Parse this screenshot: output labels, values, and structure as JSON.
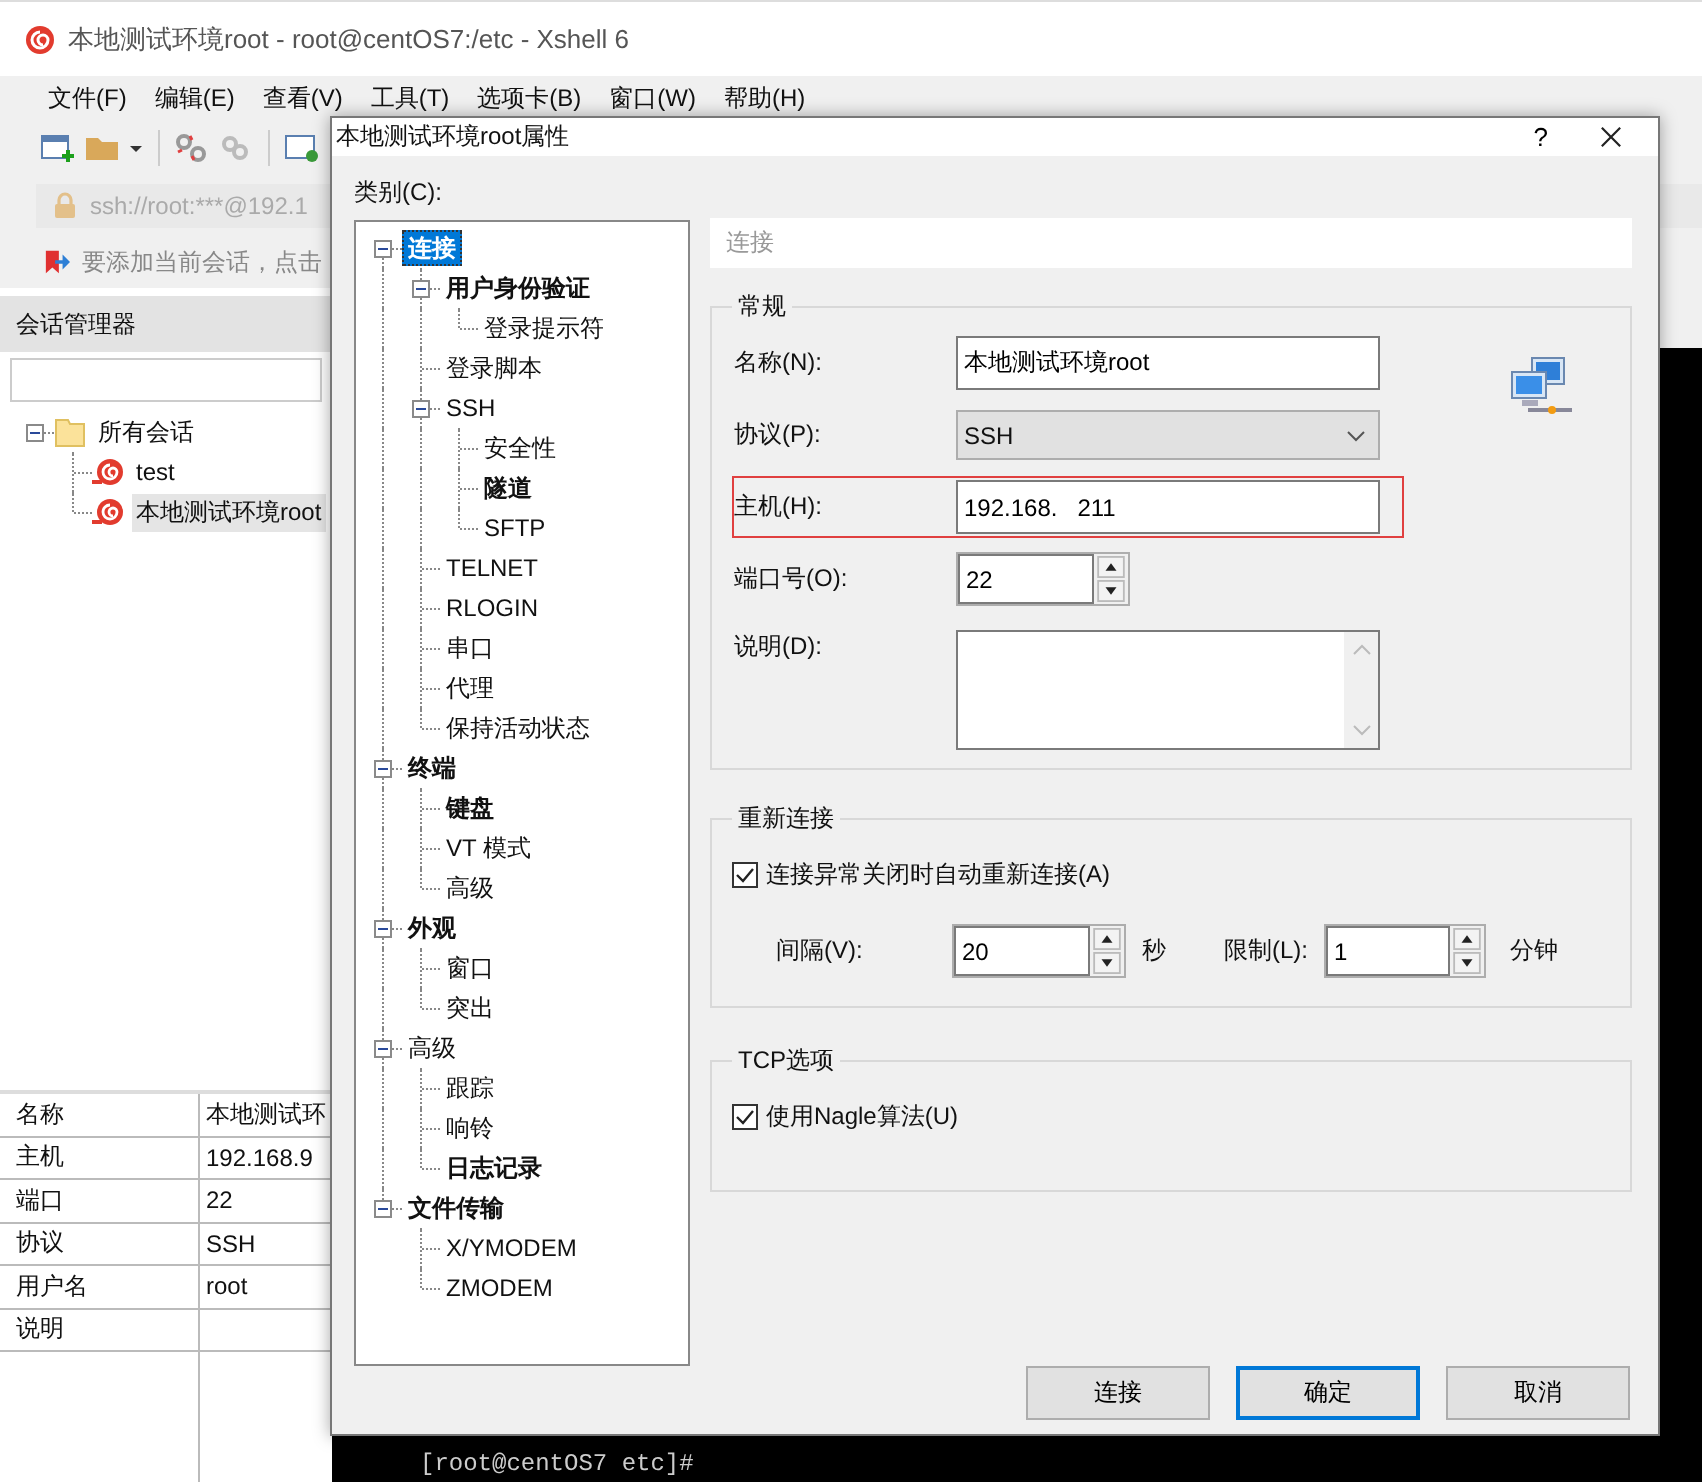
{
  "app": {
    "title": "本地测试环境root - root@centOS7:/etc - Xshell 6",
    "menu": [
      "文件(F)",
      "编辑(E)",
      "查看(V)",
      "工具(T)",
      "选项卡(B)",
      "窗口(W)",
      "帮助(H)"
    ],
    "address": "ssh://root:***@192.1",
    "hint": "要添加当前会话，点击",
    "session_manager": {
      "title": "会话管理器",
      "tree": [
        {
          "label": "所有会话",
          "kind": "folder",
          "selected": false,
          "expanded": true,
          "children": [
            {
              "label": "test",
              "kind": "session",
              "selected": false
            },
            {
              "label": "本地测试环境root",
              "kind": "session",
              "selected": true
            }
          ]
        }
      ]
    },
    "properties": [
      {
        "name": "名称",
        "value": "本地测试环"
      },
      {
        "name": "主机",
        "value": "192.168.9"
      },
      {
        "name": "端口",
        "value": "22"
      },
      {
        "name": "协议",
        "value": "SSH"
      },
      {
        "name": "用户名",
        "value": "root"
      },
      {
        "name": "说明"
      }
    ],
    "terminal": {
      "prompt": "[root@centOS7 etc]#"
    }
  },
  "dialog": {
    "title": "本地测试环境root属性",
    "help": "?",
    "category_label": "类别(C):",
    "categories": [
      {
        "label": "连接",
        "bold": true,
        "selected": true,
        "expanded": true,
        "children": [
          {
            "label": "用户身份验证",
            "bold": true,
            "selected": false,
            "expanded": true,
            "children": [
              {
                "label": "登录提示符",
                "bold": false,
                "selected": false
              }
            ]
          },
          {
            "label": "登录脚本",
            "bold": false,
            "selected": false
          },
          {
            "label": "SSH",
            "bold": false,
            "selected": false,
            "expanded": true,
            "children": [
              {
                "label": "安全性",
                "bold": false,
                "selected": false
              },
              {
                "label": "隧道",
                "bold": true,
                "selected": false
              },
              {
                "label": "SFTP",
                "bold": false,
                "selected": false
              }
            ]
          },
          {
            "label": "TELNET",
            "bold": false,
            "selected": false
          },
          {
            "label": "RLOGIN",
            "bold": false,
            "selected": false
          },
          {
            "label": "串口",
            "bold": false,
            "selected": false
          },
          {
            "label": "代理",
            "bold": false,
            "selected": false
          },
          {
            "label": "保持活动状态",
            "bold": false,
            "selected": false
          }
        ]
      },
      {
        "label": "终端",
        "bold": true,
        "selected": false,
        "expanded": true,
        "children": [
          {
            "label": "键盘",
            "bold": true,
            "selected": false
          },
          {
            "label": "VT 模式",
            "bold": false,
            "selected": false
          },
          {
            "label": "高级",
            "bold": false,
            "selected": false
          }
        ]
      },
      {
        "label": "外观",
        "bold": true,
        "selected": false,
        "expanded": true,
        "children": [
          {
            "label": "窗口",
            "bold": false,
            "selected": false
          },
          {
            "label": "突出",
            "bold": false,
            "selected": false
          }
        ]
      },
      {
        "label": "高级",
        "bold": false,
        "selected": false,
        "expanded": true,
        "children": [
          {
            "label": "跟踪",
            "bold": false,
            "selected": false
          },
          {
            "label": "响铃",
            "bold": false,
            "selected": false
          },
          {
            "label": "日志记录",
            "bold": true,
            "selected": false
          }
        ]
      },
      {
        "label": "文件传输",
        "bold": true,
        "selected": false,
        "expanded": true,
        "children": [
          {
            "label": "X/YMODEM",
            "bold": false,
            "selected": false
          },
          {
            "label": "ZMODEM",
            "bold": false,
            "selected": false
          }
        ]
      }
    ],
    "section_title": "连接",
    "general": {
      "title": "常规",
      "fields": [
        {
          "kind": "text",
          "label": "名称(N):",
          "value": "本地测试环境root",
          "highlighted": false
        },
        {
          "kind": "select",
          "label": "协议(P):",
          "value": "SSH",
          "highlighted": false
        },
        {
          "kind": "text",
          "label": "主机(H):",
          "value": "192.168.   211",
          "highlighted": true
        },
        {
          "kind": "spin",
          "label": "端口号(O):",
          "value": "22",
          "highlighted": false
        },
        {
          "kind": "textarea",
          "label": "说明(D):",
          "highlighted": false
        }
      ]
    },
    "reconnect": {
      "title": "重新连接",
      "checkbox": {
        "label": "连接异常关闭时自动重新连接(A)",
        "checked": true
      },
      "interval": {
        "label": "间隔(V):",
        "value": "20",
        "unit": "秒"
      },
      "limit": {
        "label": "限制(L):",
        "value": "1",
        "unit": "分钟"
      }
    },
    "tcp": {
      "title": "TCP选项",
      "checkbox": {
        "label": "使用Nagle算法(U)",
        "checked": true
      }
    },
    "buttons": [
      {
        "label": "连接",
        "default": false
      },
      {
        "label": "确定",
        "default": true
      },
      {
        "label": "取消",
        "default": false
      }
    ]
  }
}
